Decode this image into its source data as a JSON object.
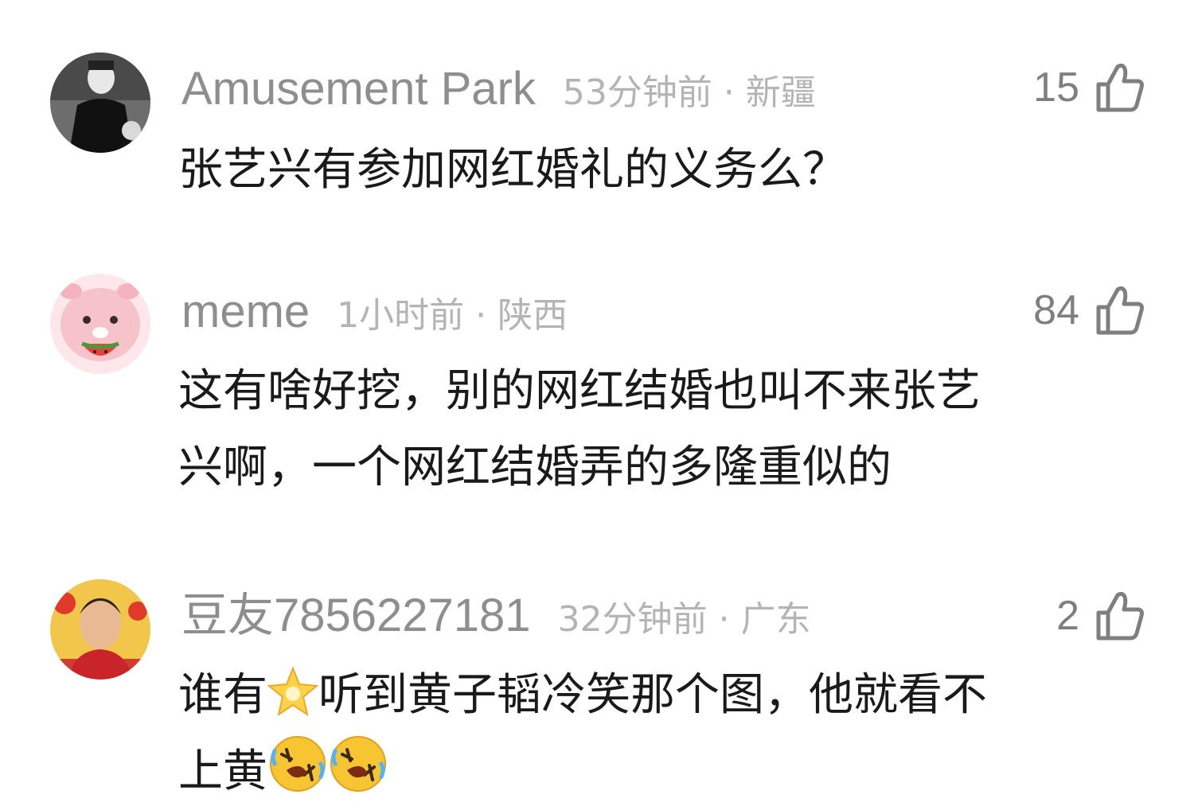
{
  "comments": [
    {
      "username": "Amusement Park",
      "time": "53分钟前",
      "separator": "·",
      "location": "新疆",
      "likes": "15",
      "text": "张艺兴有参加网红婚礼的义务么？"
    },
    {
      "username": "meme",
      "time": "1小时前",
      "separator": "·",
      "location": "陕西",
      "likes": "84",
      "line1": "这有啥好挖，别的网红结婚也叫不来张艺",
      "line2": "兴啊，一个网红结婚弄的多隆重似的"
    },
    {
      "username": "豆友7856227181",
      "time": "32分钟前",
      "separator": "·",
      "location": "广东",
      "likes": "2",
      "text_a": "谁有",
      "text_b": "听到黄子韬冷笑那个图，他就看不",
      "text_c": "上黄"
    }
  ],
  "icons": {
    "like": "thumbs-up-outline-icon",
    "star": "star-emoji-icon",
    "laugh": "rolling-on-floor-laughing-emoji-icon"
  },
  "colors": {
    "username": "#8e8e8e",
    "meta": "#b4b4b4",
    "like_count": "#7f7f7f",
    "body": "#1a1a1a",
    "emoji_yellow": "#f7c531"
  }
}
